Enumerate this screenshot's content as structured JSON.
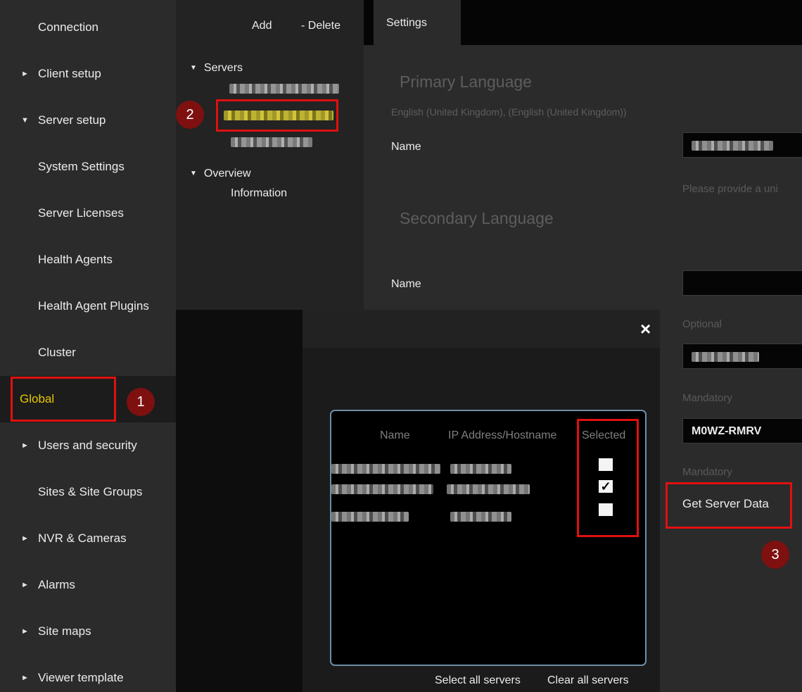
{
  "sidebar": {
    "items": [
      {
        "label": "Connection",
        "arrow": ""
      },
      {
        "label": "Client setup",
        "arrow": "►"
      },
      {
        "label": "Server setup",
        "arrow": "▼"
      },
      {
        "label": "System Settings",
        "arrow": ""
      },
      {
        "label": "Server Licenses",
        "arrow": ""
      },
      {
        "label": "Health Agents",
        "arrow": ""
      },
      {
        "label": "Health Agent Plugins",
        "arrow": ""
      },
      {
        "label": "Cluster",
        "arrow": ""
      },
      {
        "label": "Global",
        "arrow": "",
        "active": true
      },
      {
        "label": "Users and security",
        "arrow": "►"
      },
      {
        "label": "Sites & Site Groups",
        "arrow": ""
      },
      {
        "label": "NVR & Cameras",
        "arrow": "►"
      },
      {
        "label": "Alarms",
        "arrow": "►"
      },
      {
        "label": "Site maps",
        "arrow": "►"
      },
      {
        "label": "Viewer template",
        "arrow": "►"
      }
    ]
  },
  "tree": {
    "toolbar": {
      "add_label": "Add",
      "delete_label": "- Delete"
    },
    "servers_label": "Servers",
    "servers_caret": "▼",
    "overview_label": "Overview",
    "overview_caret": "▼",
    "information_label": "Information"
  },
  "settings": {
    "tab_label": "Settings",
    "primary_language_heading": "Primary Language",
    "primary_language_value": "English (United Kingdom), (English (United Kingdom))",
    "name_label": "Name",
    "name_hint": "Please provide a uni",
    "secondary_language_heading": "Secondary Language",
    "secondary_name_label": "Name",
    "optional_label": "Optional",
    "mandatory_label_1": "Mandatory",
    "license_code": "M0WZ-RMRV",
    "mandatory_label_2": "Mandatory",
    "get_server_data_label": "Get Server Data"
  },
  "dialog": {
    "close_icon": "×",
    "columns": [
      "Name",
      "IP Address/Hostname",
      "Selected"
    ],
    "rows": [
      {
        "selected": false
      },
      {
        "selected": true
      },
      {
        "selected": false
      }
    ],
    "check_glyph": "✓",
    "select_all_label": "Select all servers",
    "clear_all_label": "Clear all servers"
  },
  "annotations": {
    "badges": [
      "1",
      "2",
      "3"
    ],
    "highlight_color": "#e01010",
    "badge_color": "#7e1010"
  },
  "colors": {
    "active_nav_text": "#e8c800",
    "sidebar_bg": "#2b2b2b",
    "dialog_border": "#6f8da6"
  }
}
